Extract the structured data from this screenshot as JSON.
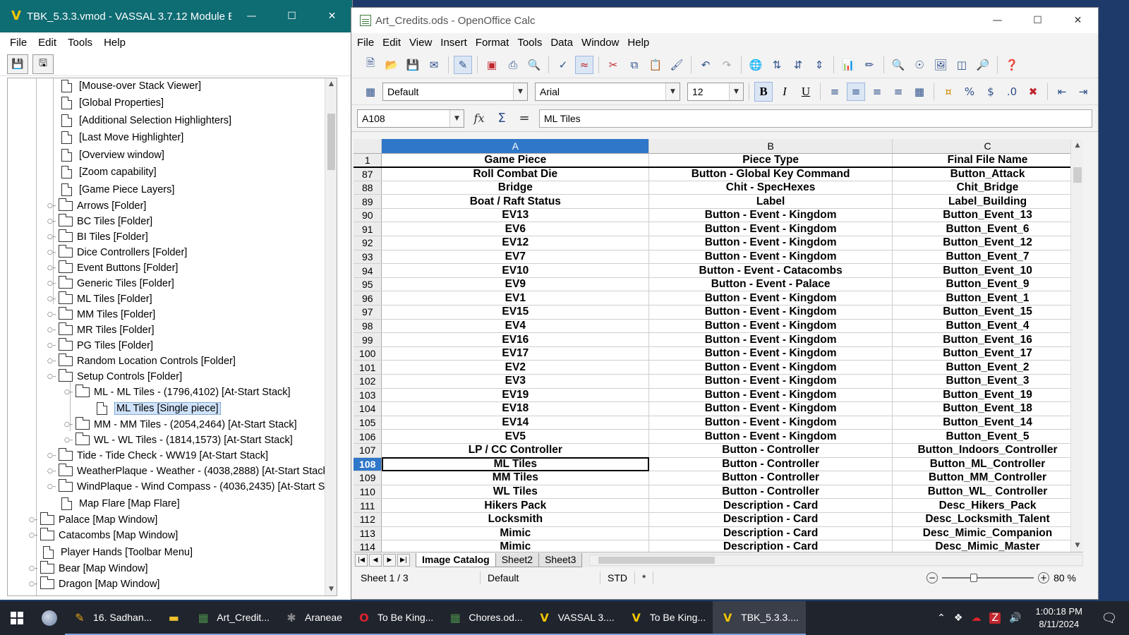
{
  "vassal": {
    "title": "TBK_5.3.3.vmod - VASSAL 3.7.12 Module E...",
    "menu": [
      "File",
      "Edit",
      "Tools",
      "Help"
    ],
    "tree": [
      {
        "label": "[Mouse-over Stack Viewer]",
        "kind": "file"
      },
      {
        "label": "[Global Properties]",
        "kind": "file"
      },
      {
        "label": "[Additional Selection Highlighters]",
        "kind": "file"
      },
      {
        "label": "[Last Move Highlighter]",
        "kind": "file"
      },
      {
        "label": "[Overview window]",
        "kind": "file"
      },
      {
        "label": "[Zoom capability]",
        "kind": "file"
      },
      {
        "label": "[Game Piece Layers]",
        "kind": "file"
      },
      {
        "label": "Arrows [Folder]",
        "kind": "folder"
      },
      {
        "label": "BC Tiles [Folder]",
        "kind": "folder"
      },
      {
        "label": "BI Tiles [Folder]",
        "kind": "folder"
      },
      {
        "label": "Dice Controllers [Folder]",
        "kind": "folder"
      },
      {
        "label": "Event Buttons [Folder]",
        "kind": "folder"
      },
      {
        "label": "Generic Tiles [Folder]",
        "kind": "folder"
      },
      {
        "label": "ML Tiles [Folder]",
        "kind": "folder"
      },
      {
        "label": "MM Tiles [Folder]",
        "kind": "folder"
      },
      {
        "label": "MR Tiles [Folder]",
        "kind": "folder"
      },
      {
        "label": "PG Tiles [Folder]",
        "kind": "folder"
      },
      {
        "label": "Random Location Controls [Folder]",
        "kind": "folder"
      },
      {
        "label": "Setup Controls [Folder]",
        "kind": "folder"
      },
      {
        "label": "ML - ML Tiles - (1796,4102) [At-Start Stack]",
        "kind": "folder"
      },
      {
        "label": "ML Tiles [Single piece]",
        "kind": "file"
      },
      {
        "label": "MM - MM Tiles - (2054,2464) [At-Start Stack]",
        "kind": "folder"
      },
      {
        "label": "WL - WL Tiles - (1814,1573) [At-Start Stack]",
        "kind": "folder"
      },
      {
        "label": "Tide - Tide Check - WW19 [At-Start Stack]",
        "kind": "folder"
      },
      {
        "label": "WeatherPlaque - Weather - (4038,2888) [At-Start Stack]",
        "kind": "folder"
      },
      {
        "label": "WindPlaque - Wind Compass - (4036,2435) [At-Start Stack]",
        "kind": "folder"
      },
      {
        "label": "Map Flare [Map Flare]",
        "kind": "file"
      },
      {
        "label": "Palace [Map Window]",
        "kind": "folder"
      },
      {
        "label": "Catacombs [Map Window]",
        "kind": "folder"
      },
      {
        "label": "Player Hands [Toolbar Menu]",
        "kind": "file"
      },
      {
        "label": "Bear [Map Window]",
        "kind": "folder"
      },
      {
        "label": "Dragon [Map Window]",
        "kind": "folder"
      }
    ]
  },
  "calc": {
    "title": "Art_Credits.ods - OpenOffice Calc",
    "menu": [
      "File",
      "Edit",
      "View",
      "Insert",
      "Format",
      "Tools",
      "Data",
      "Window",
      "Help"
    ],
    "style": "Default",
    "font": "Arial",
    "size": "12",
    "namebox": "A108",
    "formula": "ML Tiles",
    "columns": [
      "A",
      "B",
      "C"
    ],
    "header_row": {
      "num": "1",
      "a": "Game Piece",
      "b": "Piece Type",
      "c": "Final File Name"
    },
    "rows": [
      {
        "num": "87",
        "a": "Roll Combat Die",
        "b": "Button - Global Key Command",
        "c": "Button_Attack"
      },
      {
        "num": "88",
        "a": "Bridge",
        "b": "Chit - SpecHexes",
        "c": "Chit_Bridge"
      },
      {
        "num": "89",
        "a": "Boat / Raft Status",
        "b": "Label",
        "c": "Label_Building"
      },
      {
        "num": "90",
        "a": "EV13",
        "b": "Button - Event - Kingdom",
        "c": "Button_Event_13"
      },
      {
        "num": "91",
        "a": "EV6",
        "b": "Button - Event - Kingdom",
        "c": "Button_Event_6"
      },
      {
        "num": "92",
        "a": "EV12",
        "b": "Button - Event - Kingdom",
        "c": "Button_Event_12"
      },
      {
        "num": "93",
        "a": "EV7",
        "b": "Button - Event - Kingdom",
        "c": "Button_Event_7"
      },
      {
        "num": "94",
        "a": "EV10",
        "b": "Button - Event - Catacombs",
        "c": "Button_Event_10"
      },
      {
        "num": "95",
        "a": "EV9",
        "b": "Button - Event - Palace",
        "c": "Button_Event_9"
      },
      {
        "num": "96",
        "a": "EV1",
        "b": "Button - Event - Kingdom",
        "c": "Button_Event_1"
      },
      {
        "num": "97",
        "a": "EV15",
        "b": "Button - Event - Kingdom",
        "c": "Button_Event_15"
      },
      {
        "num": "98",
        "a": "EV4",
        "b": "Button - Event - Kingdom",
        "c": "Button_Event_4"
      },
      {
        "num": "99",
        "a": "EV16",
        "b": "Button - Event - Kingdom",
        "c": "Button_Event_16"
      },
      {
        "num": "100",
        "a": "EV17",
        "b": "Button - Event - Kingdom",
        "c": "Button_Event_17"
      },
      {
        "num": "101",
        "a": "EV2",
        "b": "Button - Event - Kingdom",
        "c": "Button_Event_2"
      },
      {
        "num": "102",
        "a": "EV3",
        "b": "Button - Event - Kingdom",
        "c": "Button_Event_3"
      },
      {
        "num": "103",
        "a": "EV19",
        "b": "Button - Event - Kingdom",
        "c": "Button_Event_19"
      },
      {
        "num": "104",
        "a": "EV18",
        "b": "Button - Event - Kingdom",
        "c": "Button_Event_18"
      },
      {
        "num": "105",
        "a": "EV14",
        "b": "Button - Event - Kingdom",
        "c": "Button_Event_14"
      },
      {
        "num": "106",
        "a": "EV5",
        "b": "Button - Event - Kingdom",
        "c": "Button_Event_5"
      },
      {
        "num": "107",
        "a": "LP / CC Controller",
        "b": "Button - Controller",
        "c": "Button_Indoors_Controller"
      },
      {
        "num": "108",
        "a": "ML Tiles",
        "b": "Button - Controller",
        "c": "Button_ML_Controller"
      },
      {
        "num": "109",
        "a": "MM Tiles",
        "b": "Button - Controller",
        "c": "Button_MM_Controller"
      },
      {
        "num": "110",
        "a": "WL Tiles",
        "b": "Button - Controller",
        "c": "Button_WL_ Controller"
      },
      {
        "num": "111",
        "a": "Hikers Pack",
        "b": "Description - Card",
        "c": "Desc_Hikers_Pack"
      },
      {
        "num": "112",
        "a": "Locksmith",
        "b": "Description - Card",
        "c": "Desc_Locksmith_Talent"
      },
      {
        "num": "113",
        "a": "Mimic",
        "b": "Description - Card",
        "c": "Desc_Mimic_Companion"
      },
      {
        "num": "114",
        "a": "Mimic",
        "b": "Description - Card",
        "c": "Desc_Mimic_Master"
      }
    ],
    "sheets": [
      "Image Catalog",
      "Sheet2",
      "Sheet3"
    ],
    "status": {
      "sheet": "Sheet 1 / 3",
      "page_style": "Default",
      "mode": "STD",
      "modified": "*",
      "zoom": "80 %",
      "zoom_level_percent": 80
    }
  },
  "taskbar": {
    "items": [
      {
        "label": "16. Sadhan...",
        "icon": "pen-app-icon",
        "color": "#e6a21b"
      },
      {
        "label": "",
        "icon": "file-explorer-icon",
        "color": "#f2c12e"
      },
      {
        "label": "Art_Credit...",
        "icon": "calc-icon",
        "color": "#4a8a4a"
      },
      {
        "label": "Araneae",
        "icon": "spider-icon",
        "color": "#888888"
      },
      {
        "label": "To Be King...",
        "icon": "opera-icon",
        "color": "#d9232e"
      },
      {
        "label": "Chores.od...",
        "icon": "calc-icon",
        "color": "#4a8a4a"
      },
      {
        "label": "VASSAL 3....",
        "icon": "vassal-icon",
        "color": "#f2c500"
      },
      {
        "label": "To Be King...",
        "icon": "vassal-icon",
        "color": "#f2c500"
      },
      {
        "label": "TBK_5.3.3....",
        "icon": "vassal-icon",
        "color": "#f2c500"
      }
    ],
    "time": "1:00:18 PM",
    "date": "8/11/2024"
  }
}
